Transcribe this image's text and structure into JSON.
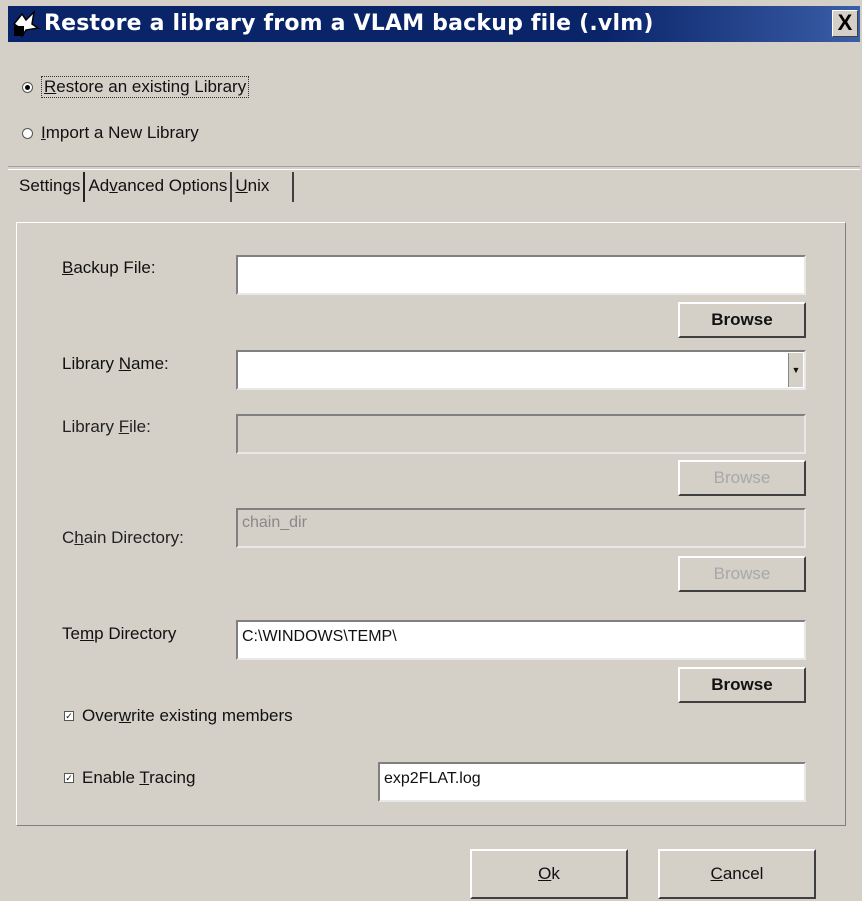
{
  "window": {
    "title": "Restore a library from a VLAM backup file (.vlm)",
    "close_label": "X"
  },
  "mode": {
    "options": [
      {
        "label_pre": "",
        "mnemonic": "R",
        "label_post": "estore an existing Library",
        "selected": true
      },
      {
        "label_pre": "",
        "mnemonic": "I",
        "label_post": "mport a New Library",
        "selected": false
      }
    ]
  },
  "tabs": [
    {
      "label_pre": "Settings",
      "mnemonic": "",
      "label_post": ""
    },
    {
      "label_pre": "Ad",
      "mnemonic": "v",
      "label_post": "anced Options"
    },
    {
      "label_pre": "",
      "mnemonic": "U",
      "label_post": "nix"
    }
  ],
  "settings": {
    "backup_file": {
      "label_pre": "",
      "mnemonic": "B",
      "label_post": "ackup File:",
      "value": ""
    },
    "library_name": {
      "label_pre": "Library ",
      "mnemonic": "N",
      "label_post": "ame:",
      "value": ""
    },
    "library_file": {
      "label_pre": "Library ",
      "mnemonic": "F",
      "label_post": "ile:",
      "value": ""
    },
    "chain_directory": {
      "label_pre": "C",
      "mnemonic": "h",
      "label_post": "ain Directory:",
      "value": "chain_dir"
    },
    "temp_directory": {
      "label_pre": "Te",
      "mnemonic": "m",
      "label_post": "p Directory",
      "value": "C:\\WINDOWS\\TEMP\\"
    },
    "browse_label": "Browse",
    "overwrite": {
      "label_pre": "Over",
      "mnemonic": "w",
      "label_post": "rite existing members",
      "checked": true
    },
    "tracing": {
      "label_pre": "Enable ",
      "mnemonic": "T",
      "label_post": "racing",
      "checked": true,
      "value": "exp2FLAT.log"
    }
  },
  "footer": {
    "ok": {
      "label_pre": "",
      "mnemonic": "O",
      "label_post": "k"
    },
    "cancel": {
      "label_pre": "",
      "mnemonic": "C",
      "label_post": "ancel"
    }
  }
}
